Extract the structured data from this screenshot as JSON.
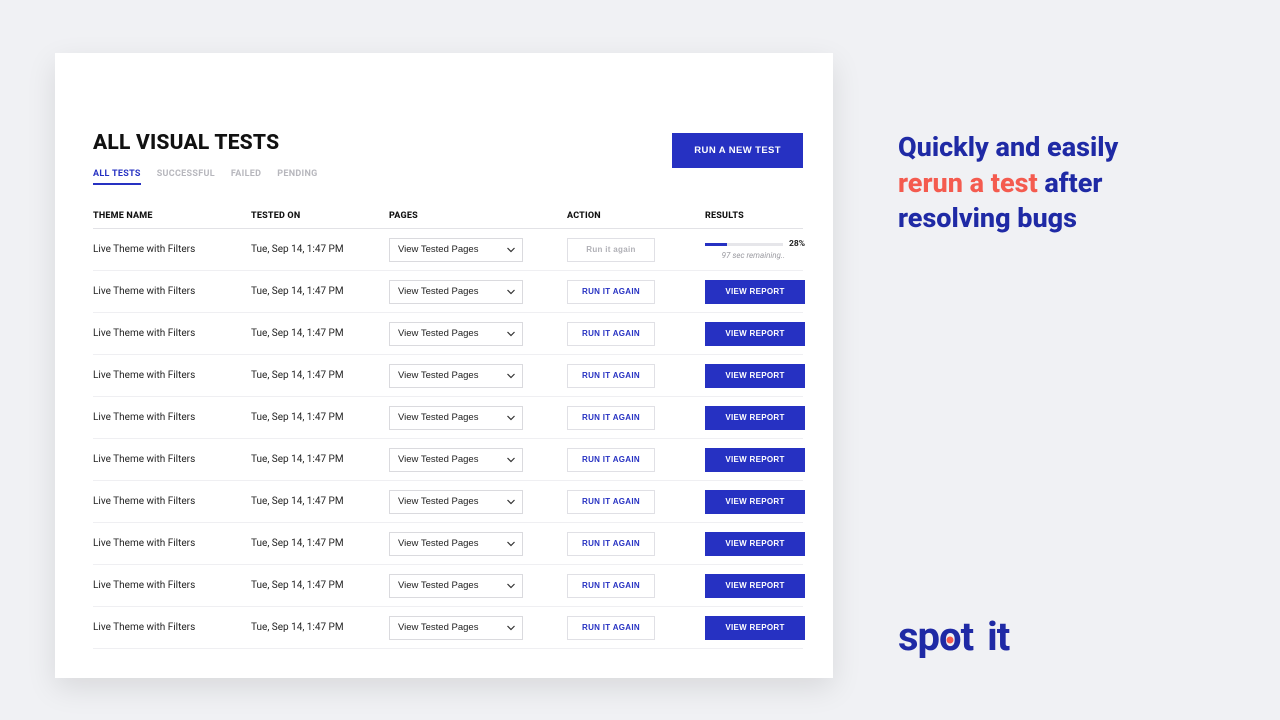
{
  "page": {
    "title": "ALL VISUAL TESTS",
    "run_new_label": "RUN A NEW TEST"
  },
  "tabs": [
    {
      "label": "ALL TESTS",
      "active": true
    },
    {
      "label": "SUCCESSFUL",
      "active": false
    },
    {
      "label": "FAILED",
      "active": false
    },
    {
      "label": "PENDING",
      "active": false
    }
  ],
  "columns": {
    "theme": "THEME NAME",
    "tested": "TESTED ON",
    "pages": "PAGES",
    "action": "ACTION",
    "results": "RESULTS"
  },
  "labels": {
    "view_tested_pages": "View Tested Pages",
    "run_it_again": "RUN IT AGAIN",
    "run_it_again_disabled": "Run it again",
    "view_report": "VIEW REPORT"
  },
  "rows": [
    {
      "theme": "Live Theme with Filters",
      "tested": "Tue, Sep 14, 1:47 PM",
      "state": "running",
      "progress_pct": 28,
      "progress_sub": "97 sec remaining.."
    },
    {
      "theme": "Live Theme with Filters",
      "tested": "Tue, Sep 14, 1:47 PM",
      "state": "done"
    },
    {
      "theme": "Live Theme with Filters",
      "tested": "Tue, Sep 14, 1:47 PM",
      "state": "done"
    },
    {
      "theme": "Live Theme with Filters",
      "tested": "Tue, Sep 14, 1:47 PM",
      "state": "done"
    },
    {
      "theme": "Live Theme with Filters",
      "tested": "Tue, Sep 14, 1:47 PM",
      "state": "done"
    },
    {
      "theme": "Live Theme with Filters",
      "tested": "Tue, Sep 14, 1:47 PM",
      "state": "done"
    },
    {
      "theme": "Live Theme with Filters",
      "tested": "Tue, Sep 14, 1:47 PM",
      "state": "done"
    },
    {
      "theme": "Live Theme with Filters",
      "tested": "Tue, Sep 14, 1:47 PM",
      "state": "done"
    },
    {
      "theme": "Live Theme with Filters",
      "tested": "Tue, Sep 14, 1:47 PM",
      "state": "done"
    },
    {
      "theme": "Live Theme with Filters",
      "tested": "Tue, Sep 14, 1:47 PM",
      "state": "done"
    }
  ],
  "promo": {
    "line1": "Quickly and easily",
    "accent": "rerun a test",
    "line2_rest": " after resolving bugs"
  },
  "logo": {
    "word1": "sp",
    "o": "o",
    "word1b": "t",
    "word2": "it"
  }
}
